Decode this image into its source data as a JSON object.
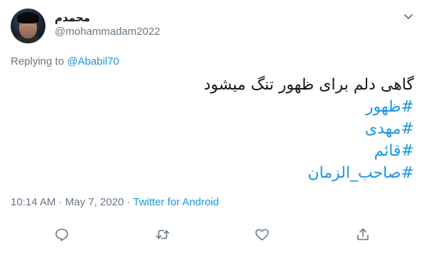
{
  "tweet": {
    "display_name": "محمدم",
    "handle": "@mohammadam2022",
    "replying_prefix": "Replying to",
    "replying_to": "@Ababil70",
    "text": "گاهی دلم برای ظهور تنگ میشود",
    "hashtags": [
      "#ظهور",
      "#مهدی",
      "#قائم",
      "#صاحب_الزمان"
    ],
    "time": "10:14 AM",
    "separator": "·",
    "date": "May 7, 2020",
    "source": "Twitter for Android"
  },
  "icons": {
    "more": "chevron-down-icon",
    "reply": "reply-icon",
    "retweet": "retweet-icon",
    "like": "like-icon",
    "share": "share-icon"
  },
  "colors": {
    "link": "#1b95e0",
    "muted": "#657786",
    "text": "#14171a",
    "background": "#ffffff"
  }
}
